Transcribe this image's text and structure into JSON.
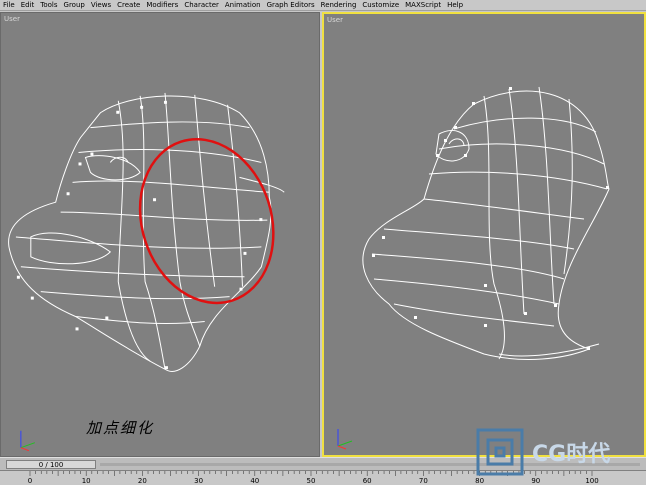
{
  "menu": [
    "File",
    "Edit",
    "Tools",
    "Group",
    "Views",
    "Create",
    "Modifiers",
    "Character",
    "Animation",
    "Graph Editors",
    "Rendering",
    "Customize",
    "MAXScript",
    "Help"
  ],
  "viewports": {
    "left_label": "User",
    "right_label": "User"
  },
  "caption": "加点细化",
  "timeline": {
    "slider_text": "0 / 100"
  },
  "ruler": {
    "labels": [
      "0",
      "10",
      "20",
      "30",
      "40",
      "50",
      "60",
      "70",
      "80",
      "90",
      "100"
    ]
  },
  "watermark": {
    "text": "CG时代"
  },
  "colors": {
    "viewport_bg": "#808080",
    "wire": "#ffffff",
    "highlight_circle": "#e01010",
    "active_border": "#f0e040"
  }
}
